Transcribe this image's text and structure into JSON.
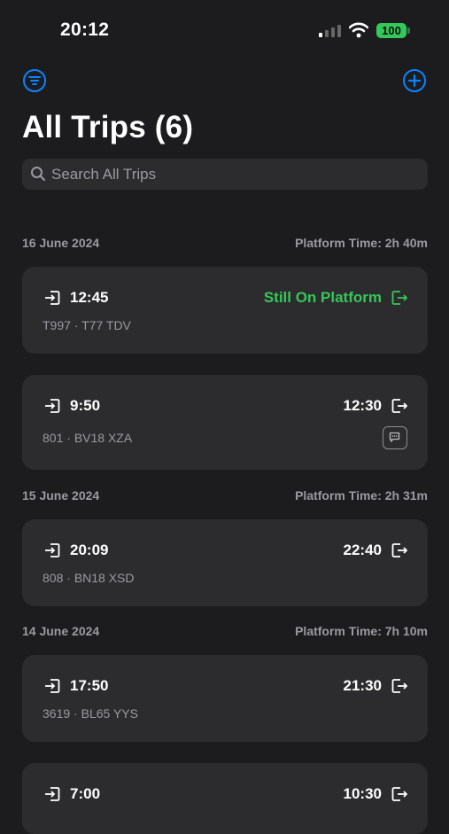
{
  "status_bar": {
    "time": "20:12",
    "battery": "100"
  },
  "header": {
    "title": "All Trips (6)",
    "filter_icon": "filter-icon",
    "add_icon": "plus-circle-icon"
  },
  "search": {
    "placeholder": "Search All Trips"
  },
  "sections": [
    {
      "date": "16 June 2024",
      "platform_time": "Platform Time: 2h 40m",
      "trips": [
        {
          "start": "12:45",
          "end": "Still On Platform",
          "route": "T997",
          "vehicle": "T77 TDV",
          "has_note": false
        },
        {
          "start": "9:50",
          "end": "12:30",
          "route": "801",
          "vehicle": "BV18 XZA",
          "has_note": true
        }
      ]
    },
    {
      "date": "15 June 2024",
      "platform_time": "Platform Time: 2h 31m",
      "trips": [
        {
          "start": "20:09",
          "end": "22:40",
          "route": "808",
          "vehicle": "BN18 XSD",
          "has_note": false
        }
      ]
    },
    {
      "date": "14 June 2024",
      "platform_time": "Platform Time: 7h 10m",
      "trips": [
        {
          "start": "17:50",
          "end": "21:30",
          "route": "3619",
          "vehicle": "BL65 YYS",
          "has_note": false
        },
        {
          "start": "7:00",
          "end": "10:30",
          "route": "",
          "vehicle": "",
          "has_note": false
        }
      ]
    }
  ],
  "colors": {
    "background": "#1c1c1e",
    "card": "#2c2c2e",
    "accent": "#0a84ff",
    "ongoing": "#34c759"
  }
}
